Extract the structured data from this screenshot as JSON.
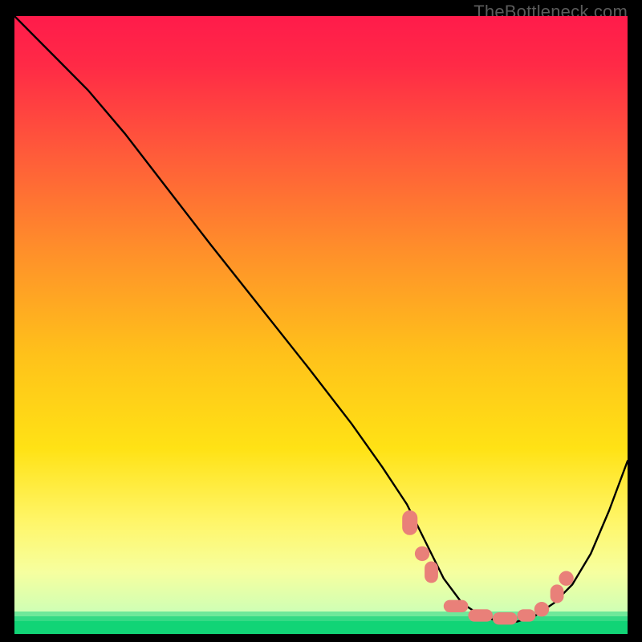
{
  "watermark": "TheBottleneck.com",
  "chart_data": {
    "type": "line",
    "title": "",
    "xlabel": "",
    "ylabel": "",
    "xlim": [
      0,
      100
    ],
    "ylim": [
      0,
      100
    ],
    "background": {
      "top_color": "#ff1b4b",
      "mid_color": "#ffe215",
      "low_color": "#f6ff9f",
      "bottom_band_color": "#11d476"
    },
    "curve": {
      "description": "Black bottleneck-style curve: steep descent from top-left, flat valley near x≈70–85, then rises to right edge.",
      "x": [
        0,
        3,
        7,
        12,
        18,
        25,
        32,
        40,
        48,
        55,
        60,
        64,
        67,
        70,
        73,
        76,
        79,
        82,
        85,
        88,
        91,
        94,
        97,
        100
      ],
      "y": [
        100,
        97,
        93,
        88,
        81,
        72,
        63,
        53,
        43,
        34,
        27,
        21,
        15,
        9,
        5,
        3,
        2,
        2,
        3,
        5,
        8,
        13,
        20,
        28
      ]
    },
    "marker_series": {
      "description": "Salmon pill/dot markers along the valley (bottleneck sweet-spot highlights).",
      "points": [
        {
          "x": 64.5,
          "y": 18,
          "shape": "pill",
          "w": 2.5,
          "h": 4
        },
        {
          "x": 66.5,
          "y": 13,
          "shape": "dot",
          "r": 1.2
        },
        {
          "x": 68,
          "y": 10,
          "shape": "pill",
          "w": 2.2,
          "h": 3.5
        },
        {
          "x": 72,
          "y": 4.5,
          "shape": "pill",
          "w": 4,
          "h": 2
        },
        {
          "x": 76,
          "y": 3,
          "shape": "pill",
          "w": 4,
          "h": 2
        },
        {
          "x": 80,
          "y": 2.5,
          "shape": "pill",
          "w": 4,
          "h": 2
        },
        {
          "x": 83.5,
          "y": 3,
          "shape": "pill",
          "w": 3,
          "h": 2
        },
        {
          "x": 86,
          "y": 4,
          "shape": "dot",
          "r": 1.2
        },
        {
          "x": 88.5,
          "y": 6.5,
          "shape": "pill",
          "w": 2.2,
          "h": 3
        },
        {
          "x": 90,
          "y": 9,
          "shape": "dot",
          "r": 1.2
        }
      ],
      "color": "#e98079"
    }
  }
}
